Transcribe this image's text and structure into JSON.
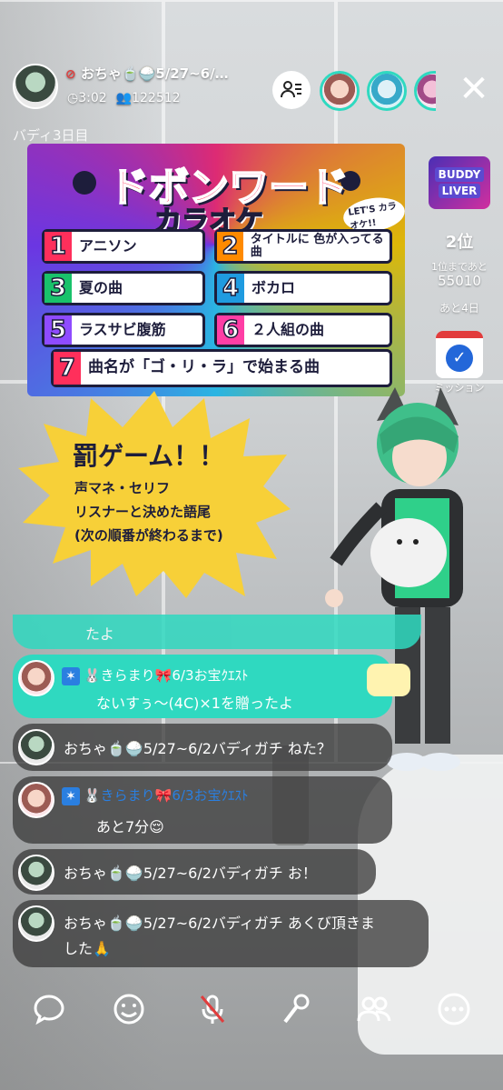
{
  "host": {
    "name": "おちゃ🍵🍚5/27~6/…",
    "time": "3:02",
    "listeners": "122512"
  },
  "buddy_day": "バディ3日目",
  "banner": {
    "title": "ドボンワード",
    "subtitle": "カラオケ",
    "lets": "LET'S カラオケ!!",
    "items": [
      {
        "num": "1",
        "text": "アニソン"
      },
      {
        "num": "2",
        "text": "タイトルに 色が入ってる曲"
      },
      {
        "num": "3",
        "text": "夏の曲"
      },
      {
        "num": "4",
        "text": "ボカロ"
      },
      {
        "num": "5",
        "text": "ラスサビ腹筋"
      },
      {
        "num": "6",
        "text": "２人組の曲"
      },
      {
        "num": "7",
        "text": "曲名が「ゴ・リ・ラ」で始まる曲"
      }
    ]
  },
  "ranking": {
    "logo_line1": "BUDDY",
    "logo_line2": "LIVER",
    "rank": "2位",
    "to_first_label": "1位まであと",
    "to_first_points": "55010",
    "days_left": "あと4日",
    "mission_label": "ミッション"
  },
  "penalty": {
    "title": "罰ゲーム！！",
    "lines": [
      "声マネ・セリフ",
      "リスナーと決めた語尾",
      "(次の順番が終わるまで)"
    ]
  },
  "chat": [
    {
      "type": "teal-partial",
      "text": "たよ"
    },
    {
      "type": "gift",
      "name": "🐰きらまり🎀6/3お宝ｸｴｽﾄ",
      "text": "ないすぅ〜(4C)×1を贈ったよ"
    },
    {
      "type": "msg",
      "name": "おちゃ🍵🍚5/27~6/2バディガチ",
      "text": "ねた？"
    },
    {
      "type": "msg2",
      "name": "🐰きらまり🎀6/3お宝ｸｴｽﾄ",
      "text": "あと7分😌"
    },
    {
      "type": "msg",
      "name": "おちゃ🍵🍚5/27~6/2バディガチ",
      "text": "お！"
    },
    {
      "type": "msg",
      "name": "おちゃ🍵🍚5/27~6/2バディガチ",
      "text": "あくび頂きま",
      "text2": "した🙏"
    }
  ],
  "colors": {
    "accent_teal": "#2fd9c0",
    "badge_blue": "#2a7fe0",
    "mute_red": "#e03c3c"
  }
}
